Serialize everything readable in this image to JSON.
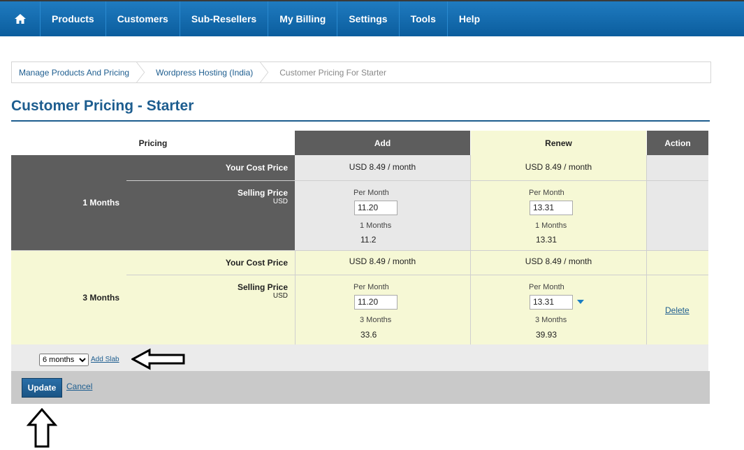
{
  "nav": {
    "home_icon": "home-icon",
    "items": [
      "Products",
      "Customers",
      "Sub-Resellers",
      "My Billing",
      "Settings",
      "Tools",
      "Help"
    ]
  },
  "breadcrumb": [
    "Manage Products And Pricing",
    "Wordpress Hosting (India)",
    "Customer Pricing For Starter"
  ],
  "page_title": "Customer Pricing - Starter",
  "table": {
    "headers": {
      "pricing": "Pricing",
      "add": "Add",
      "renew": "Renew",
      "action": "Action"
    },
    "rows": [
      {
        "period": "1 Months",
        "cost_label": "Your Cost Price",
        "selling_label": "Selling Price",
        "currency": "USD",
        "add_cost": "USD 8.49 / month",
        "renew_cost": "USD 8.49 / month",
        "per_month_label": "Per Month",
        "add_price": "11.20",
        "renew_price": "13.31",
        "duration": "1 Months",
        "add_total": "11.2",
        "renew_total": "13.31"
      },
      {
        "period": "3 Months",
        "cost_label": "Your Cost Price",
        "selling_label": "Selling Price",
        "currency": "USD",
        "add_cost": "USD 8.49 / month",
        "renew_cost": "USD 8.49 / month",
        "per_month_label": "Per Month",
        "add_price": "11.20",
        "renew_price": "13.31",
        "duration": "3 Months",
        "add_total": "33.6",
        "renew_total": "39.93",
        "action": "Delete"
      }
    ]
  },
  "slab": {
    "selected": "6 months",
    "add_label": "Add Slab"
  },
  "footer": {
    "update_label": "Update",
    "cancel_label": "Cancel"
  },
  "colors": {
    "nav": "#1f7bc0",
    "accent": "#1d5d8f",
    "dark_cell": "#5d5d5d",
    "renew_bg": "#f6f8d5"
  }
}
